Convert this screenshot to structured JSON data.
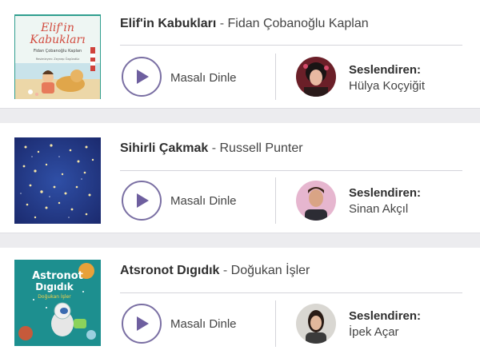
{
  "stories": [
    {
      "title": "Elif'in Kabukları",
      "separator": " - ",
      "author": "Fidan Çobanoğlu Kaplan",
      "listen_label": "Masalı Dinle",
      "narrator_label": "Seslendiren:",
      "narrator": "Hülya Koçyiğit",
      "cover": {
        "title_line1": "Elif'in",
        "title_line2": "Kabukları",
        "author_line": "Fidan Çobanoğlu Kaplan",
        "illustrator_line": "Resimleyen: Zeynep Özgündüz"
      }
    },
    {
      "title": "Sihirli Çakmak",
      "separator": " - ",
      "author": "Russell Punter",
      "listen_label": "Masalı Dinle",
      "narrator_label": "Seslendiren:",
      "narrator": "Sinan Akçıl"
    },
    {
      "title": "Atsronot Dıgıdık",
      "separator": " - ",
      "author": "Doğukan İşler",
      "listen_label": "Masalı Dinle",
      "narrator_label": "Seslendiren:",
      "narrator": "İpek Açar",
      "cover": {
        "title_line1": "Astronot",
        "title_line2": "Dıgıdık",
        "author_line": "Doğukan İşler"
      }
    }
  ],
  "colors": {
    "accent": "#6e5f9f",
    "page_background": "#ececef",
    "card_background": "#ffffff"
  }
}
